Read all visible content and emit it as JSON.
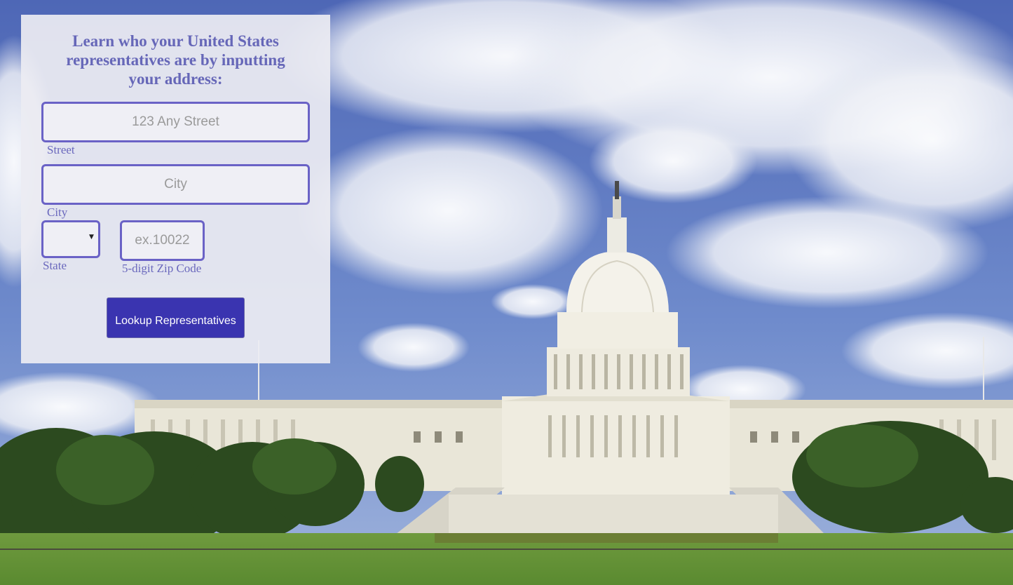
{
  "form": {
    "heading": "Learn who your United States representatives are by inputting your address:",
    "street": {
      "placeholder": "123 Any Street",
      "label": "Street"
    },
    "city": {
      "placeholder": "City",
      "label": "City"
    },
    "state": {
      "value": "",
      "label": "State"
    },
    "zip": {
      "placeholder": "ex.10022",
      "label": "5-digit Zip Code"
    },
    "submit_label": "Lookup Representatives"
  },
  "colors": {
    "accent": "#6a62c6",
    "button": "#3a34b0",
    "heading": "#6667b8",
    "panel": "#ececf2"
  },
  "background": {
    "subject": "capitol-building-photo"
  }
}
